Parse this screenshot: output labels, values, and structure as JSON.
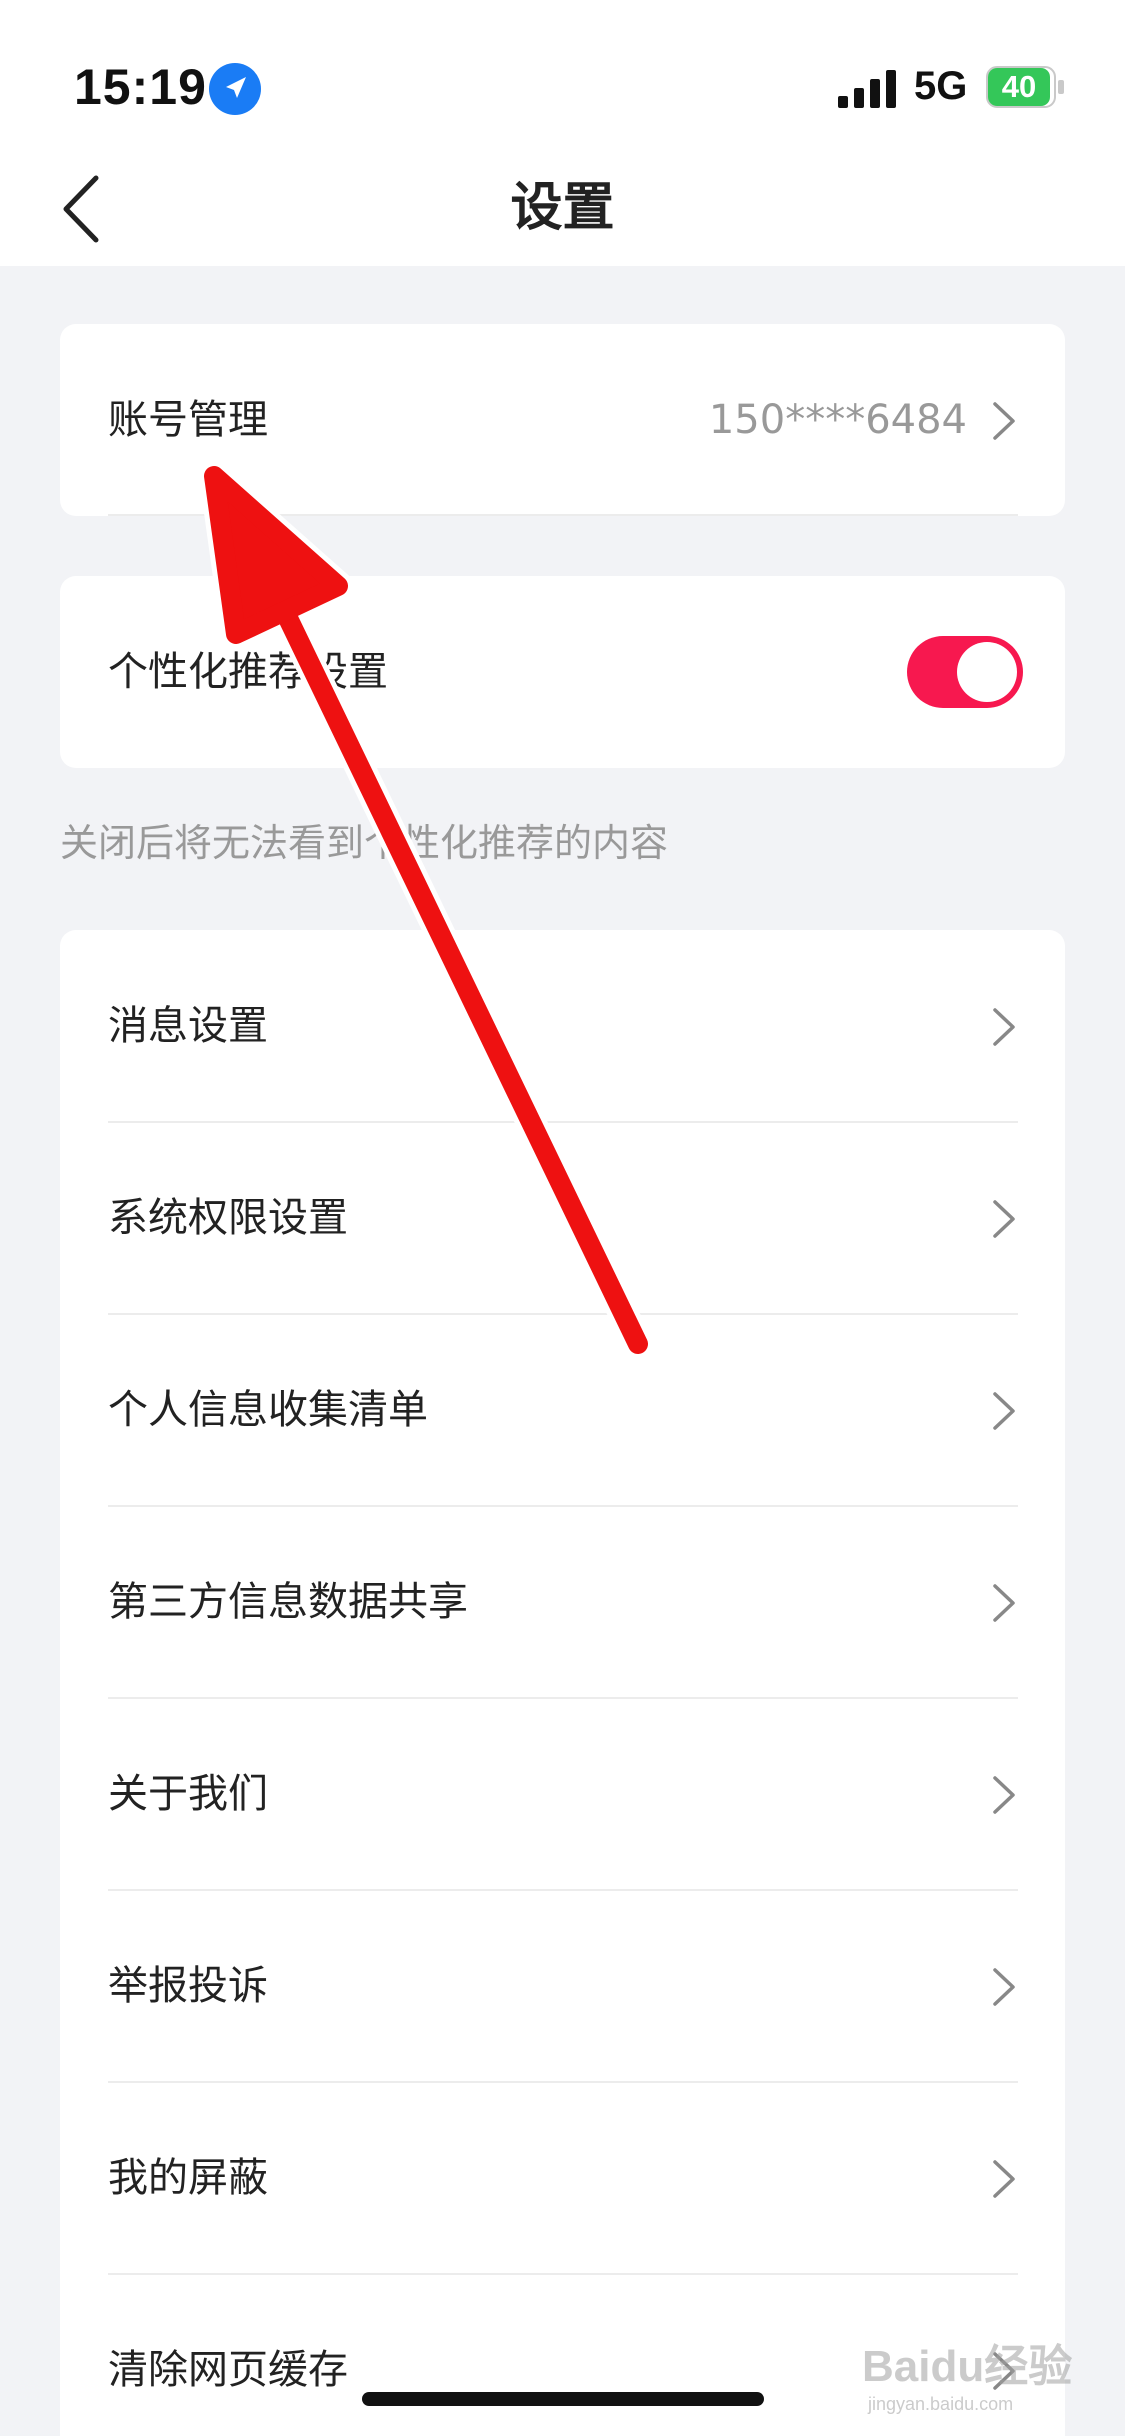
{
  "status_bar": {
    "time": "15:19",
    "network": "5G",
    "battery": "40"
  },
  "header": {
    "title": "设置"
  },
  "account_card": {
    "label": "账号管理",
    "value": "150****6484"
  },
  "personalization_card": {
    "label": "个性化推荐设置",
    "toggle_on": true,
    "hint": "关闭后将无法看到个性化推荐的内容"
  },
  "menu": {
    "items": [
      {
        "label": "消息设置"
      },
      {
        "label": "系统权限设置"
      },
      {
        "label": "个人信息收集清单"
      },
      {
        "label": "第三方信息数据共享"
      },
      {
        "label": "关于我们"
      },
      {
        "label": "举报投诉"
      },
      {
        "label": "我的屏蔽"
      },
      {
        "label": "清除网页缓存"
      }
    ]
  },
  "watermark": {
    "main": "Baidu经验",
    "sub": "jingyan.baidu.com"
  },
  "colors": {
    "toggle_active": "#f7184f",
    "annotation_arrow": "#ee1111",
    "page_bg": "#f2f3f6"
  }
}
